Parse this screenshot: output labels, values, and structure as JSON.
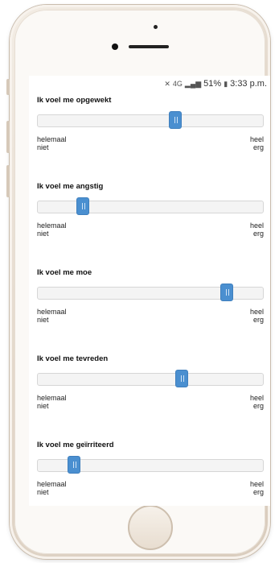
{
  "status": {
    "icons": [
      "mute-icon",
      "4g-icon",
      "signal-icon",
      "battery-icon"
    ],
    "network": "4G",
    "battery": "51%",
    "time": "3:33 p.m."
  },
  "scale": {
    "low_line1": "helemaal",
    "low_line2": "niet",
    "high_line1": "heel",
    "high_line2": "erg"
  },
  "questions": [
    {
      "label": "Ik voel me opgewekt",
      "value_percent": 61
    },
    {
      "label": "Ik voel me angstig",
      "value_percent": 20
    },
    {
      "label": "Ik voel me moe",
      "value_percent": 84
    },
    {
      "label": "Ik voel me tevreden",
      "value_percent": 64
    },
    {
      "label": "Ik voel me geïrriteerd",
      "value_percent": 16
    }
  ],
  "colors": {
    "slider_handle": "#4a8fd0",
    "track": "#f4f4f4"
  }
}
